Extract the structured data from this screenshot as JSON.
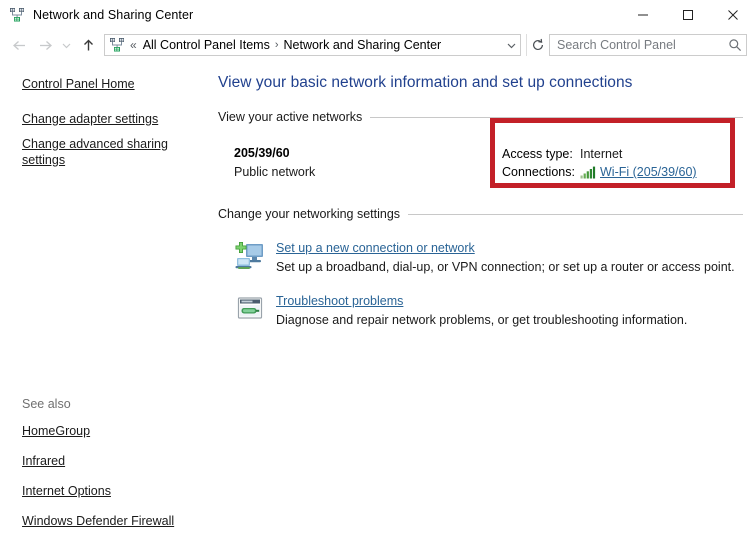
{
  "window": {
    "title": "Network and Sharing Center",
    "icon": "network-sharing-icon",
    "minimize_label": "–",
    "maximize_label": "□",
    "close_label": "✕"
  },
  "navbar": {
    "back_icon": "arrow-left-icon",
    "forward_icon": "arrow-right-icon",
    "history_icon": "chevron-down-icon",
    "up_icon": "arrow-up-icon",
    "address_icon": "network-sharing-icon",
    "crumb_prefix": "«",
    "crumbs": [
      {
        "label": "All Control Panel Items"
      },
      {
        "label": "Network and Sharing Center"
      }
    ],
    "crumb_separator": "›",
    "dropdown_icon": "chevron-down-icon",
    "refresh_icon": "refresh-icon"
  },
  "search": {
    "placeholder": "Search Control Panel",
    "value": "",
    "icon": "search-icon"
  },
  "sidebar": {
    "primary": [
      {
        "label": "Control Panel Home"
      },
      {
        "label": "Change adapter settings"
      },
      {
        "label": "Change advanced sharing settings"
      }
    ],
    "see_also_title": "See also",
    "see_also": [
      {
        "label": "HomeGroup"
      },
      {
        "label": "Infrared"
      },
      {
        "label": "Internet Options"
      },
      {
        "label": "Windows Defender Firewall"
      }
    ]
  },
  "main": {
    "heading": "View your basic network information and set up connections",
    "active_networks": {
      "section_title": "View your active networks",
      "network_name": "205/39/60",
      "network_type": "Public network",
      "access_type_label": "Access type:",
      "access_type_value": "Internet",
      "connections_label": "Connections:",
      "connection_icon": "wifi-signal-icon",
      "connection_link": "Wi-Fi (205/39/60)"
    },
    "networking_settings": {
      "section_title": "Change your networking settings",
      "items": [
        {
          "icon": "new-connection-icon",
          "link": "Set up a new connection or network",
          "description": "Set up a broadband, dial-up, or VPN connection; or set up a router or access point."
        },
        {
          "icon": "troubleshoot-icon",
          "link": "Troubleshoot problems",
          "description": "Diagnose and repair network problems, or get troubleshooting information."
        }
      ]
    }
  },
  "annotation": {
    "highlight_color": "#c32028",
    "shape": "rectangle"
  }
}
